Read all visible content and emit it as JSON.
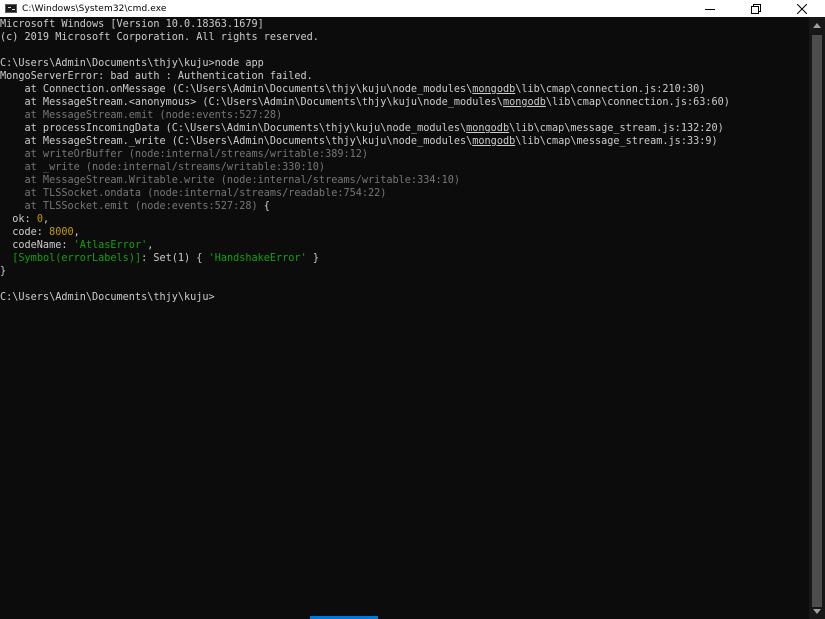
{
  "window": {
    "title": "C:\\Windows\\System32\\cmd.exe",
    "icon": "cmd-icon",
    "buttons": [
      "minimize-icon",
      "maximize-icon",
      "close-icon"
    ]
  },
  "console": {
    "lines": {
      "l0": "Microsoft Windows [Version 10.0.18363.1679]",
      "l1": "(c) 2019 Microsoft Corporation. All rights reserved.",
      "l3": "C:\\Users\\Admin\\Documents\\thjy\\kuju>node app",
      "l4": "MongoServerError: bad auth : Authentication failed.",
      "l5a": "    at Connection.onMessage (C:\\Users\\Admin\\Documents\\thjy\\kuju\\node_modules\\",
      "l5b": "mongodb",
      "l5c": "\\lib\\cmap\\connection.js:210:30)",
      "l6a": "    at MessageStream.<anonymous> (C:\\Users\\Admin\\Documents\\thjy\\kuju\\node_modules\\",
      "l6b": "mongodb",
      "l6c": "\\lib\\cmap\\connection.js:63:60)",
      "l7": "    at MessageStream.emit (node:events:527:28)",
      "l8a": "    at processIncomingData (C:\\Users\\Admin\\Documents\\thjy\\kuju\\node_modules\\",
      "l8b": "mongodb",
      "l8c": "\\lib\\cmap\\message_stream.js:132:20)",
      "l9a": "    at MessageStream._write (C:\\Users\\Admin\\Documents\\thjy\\kuju\\node_modules\\",
      "l9b": "mongodb",
      "l9c": "\\lib\\cmap\\message_stream.js:33:9)",
      "l10": "    at writeOrBuffer (node:internal/streams/writable:389:12)",
      "l11": "    at _write (node:internal/streams/writable:330:10)",
      "l12": "    at MessageStream.Writable.write (node:internal/streams/writable:334:10)",
      "l13": "    at TLSSocket.ondata (node:internal/streams/readable:754:22)",
      "l14a": "    at TLSSocket.emit (node:events:527:28)",
      "l14b": " {",
      "l15a": "  ok: ",
      "l15b": "0",
      "l15c": ",",
      "l16a": "  code: ",
      "l16b": "8000",
      "l16c": ",",
      "l17a": "  codeName: ",
      "l17b": "'AtlasError'",
      "l17c": ",",
      "l18a": "  ",
      "l18b": "[Symbol(errorLabels)]",
      "l18c": ": Set(1) { ",
      "l18d": "'HandshakeError'",
      "l18e": " }",
      "l19": "}",
      "l21": "C:\\Users\\Admin\\Documents\\thjy\\kuju>"
    }
  },
  "colors": {
    "background": "#0c0c0c",
    "text": "#cccccc",
    "dim": "#767676",
    "number": "#c19c00",
    "string": "#13a10e"
  }
}
